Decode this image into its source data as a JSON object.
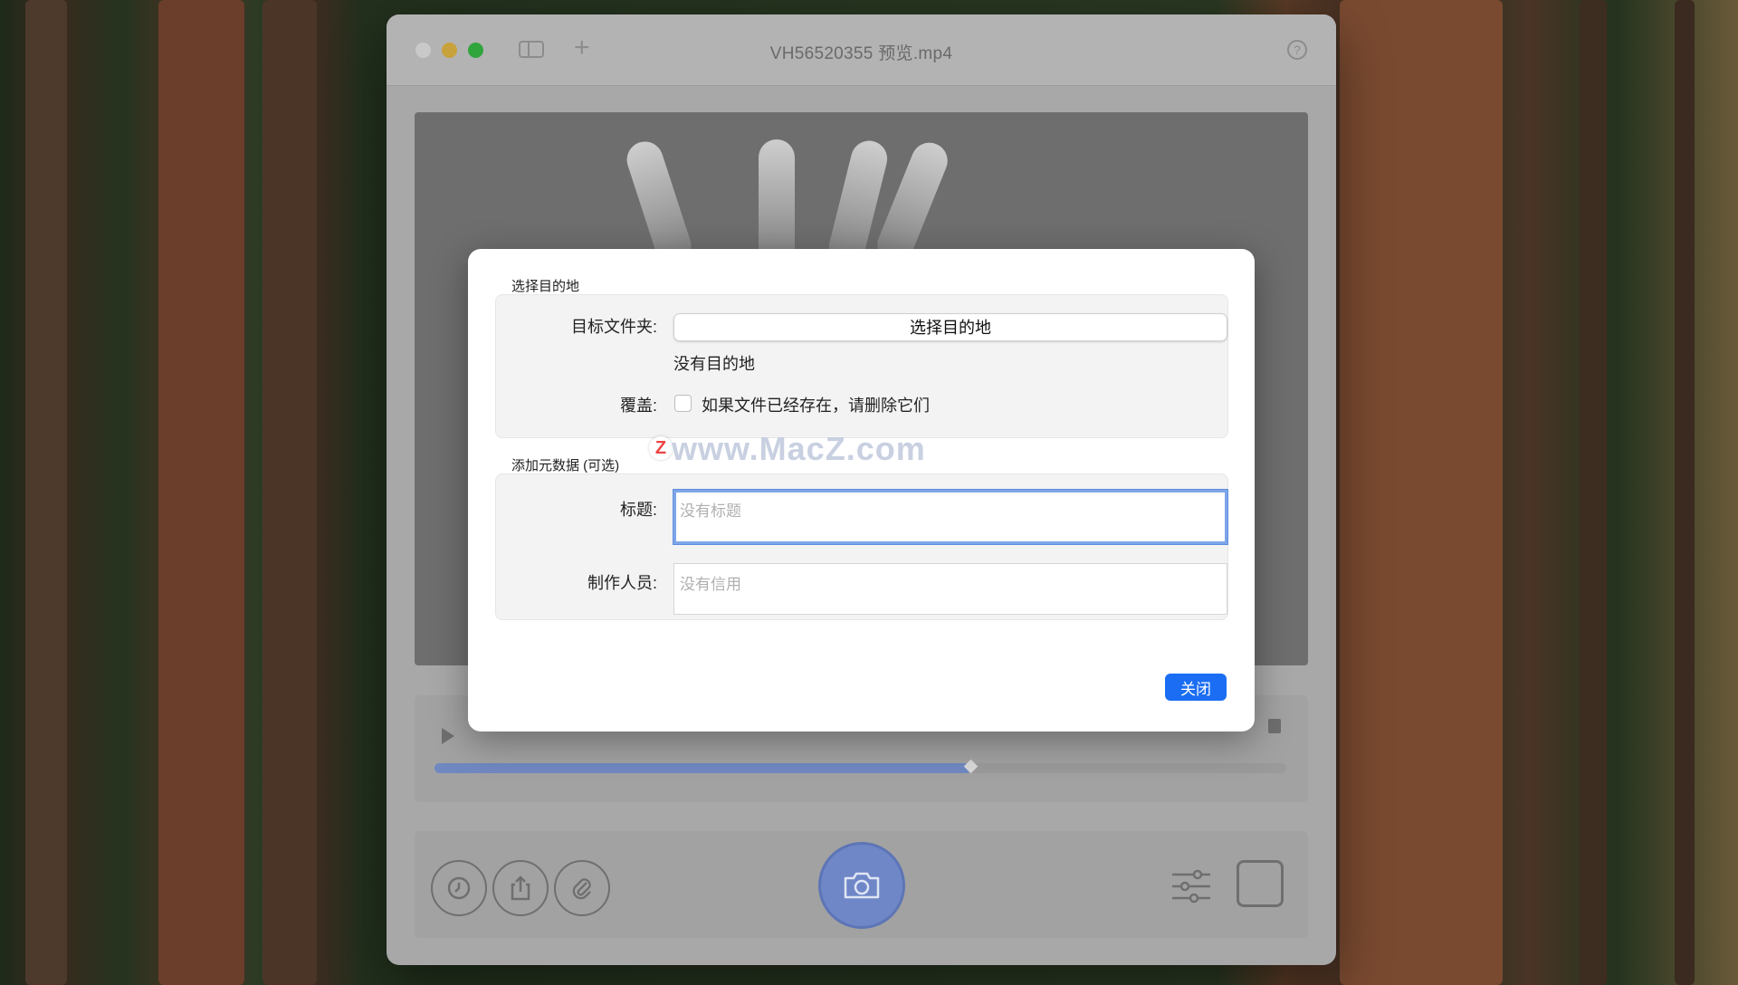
{
  "window": {
    "title": "VH56520355 预览.mp4"
  },
  "dialog": {
    "destination_section_title": "选择目的地",
    "target_folder_label": "目标文件夹:",
    "choose_destination_button": "选择目的地",
    "no_destination_text": "没有目的地",
    "overwrite_label": "覆盖:",
    "overwrite_checkbox_label": "如果文件已经存在，请删除它们",
    "overwrite_checked": false,
    "metadata_section_title": "添加元数据 (可选)",
    "title_label": "标题:",
    "title_placeholder": "没有标题",
    "credits_label": "制作人员:",
    "credits_placeholder": "没有信用",
    "close_button": "关闭"
  },
  "watermark": {
    "badge": "Z",
    "text": "www.MacZ.com"
  },
  "timeline": {
    "progress": 0.63
  },
  "colors": {
    "accent": "#1b6ef3",
    "focus_ring": "#7ea6e8"
  },
  "icons": [
    "sidebar-toggle-icon",
    "plus-icon",
    "help-icon",
    "play-icon",
    "lock-icon",
    "timer-icon",
    "share-icon",
    "paperclip-icon",
    "camera-icon",
    "sliders-icon"
  ]
}
